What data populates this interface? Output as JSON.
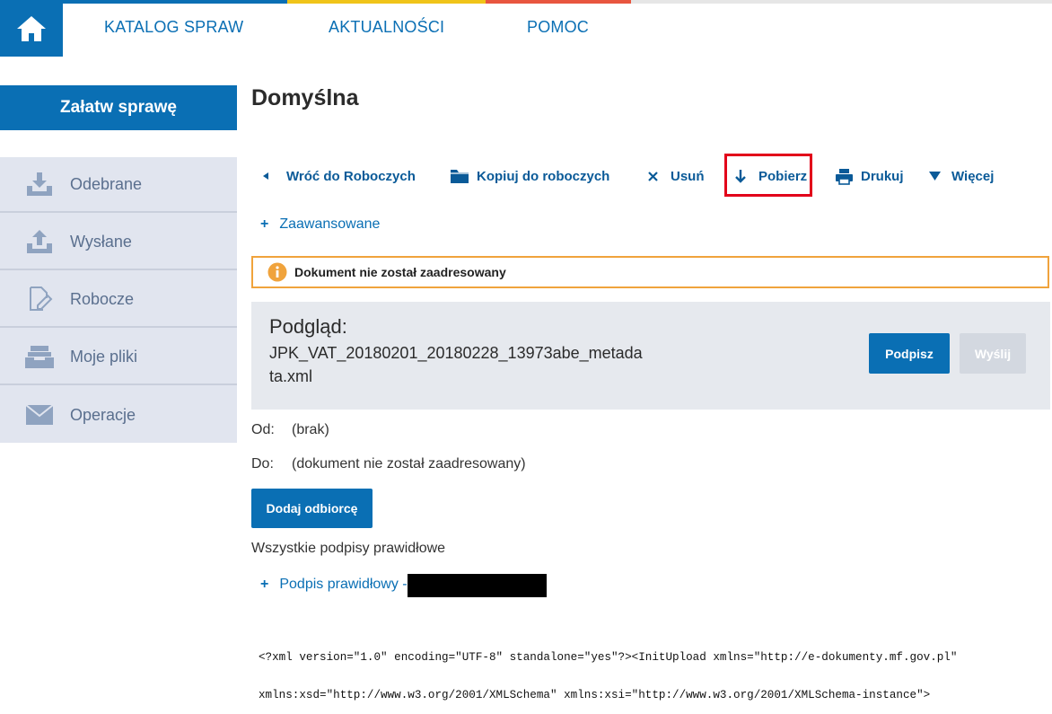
{
  "nav": {
    "home_icon": "house-icon",
    "items": [
      "KATALOG SPRAW",
      "AKTUALNOŚCI",
      "POMOC"
    ],
    "stripe_colors": [
      "#0a6fb4",
      "#f0c419",
      "#e8563f",
      "#e6e6e6"
    ]
  },
  "sidebar": {
    "settle_button": "Załatw sprawę",
    "items": [
      {
        "label": "Odebrane",
        "icon": "inbox-download-icon"
      },
      {
        "label": "Wysłane",
        "icon": "upload-icon"
      },
      {
        "label": "Robocze",
        "icon": "edit-document-icon"
      },
      {
        "label": "Moje pliki",
        "icon": "file-tray-icon"
      },
      {
        "label": "Operacje",
        "icon": "envelope-icon"
      }
    ]
  },
  "page": {
    "title": "Domyślna"
  },
  "toolbar": {
    "back": "Wróć do Roboczych",
    "copy": "Kopiuj do roboczych",
    "delete": "Usuń",
    "download": "Pobierz",
    "print": "Drukuj",
    "more": "Więcej"
  },
  "advanced": "Zaawansowane",
  "warning": "Dokument nie został zaadresowany",
  "preview": {
    "heading": "Podgląd:",
    "filename": "JPK_VAT_20180201_20180228_13973abe_metadata.xml",
    "sign_button": "Podpisz",
    "send_button": "Wyślij"
  },
  "meta": {
    "from_label": "Od:",
    "from_value": "(brak)",
    "to_label": "Do:",
    "to_value": "(dokument nie został zaadresowany)"
  },
  "add_recipient": "Dodaj odbiorcę",
  "signatures": {
    "summary": "Wszystkie podpisy prawidłowe",
    "item": "Podpis prawidłowy -"
  },
  "xml_lines": [
    "<?xml version=\"1.0\" encoding=\"UTF-8\" standalone=\"yes\"?><InitUpload xmlns=\"http://e-dokumenty.mf.gov.pl\"",
    "xmlns:xsd=\"http://www.w3.org/2001/XMLSchema\" xmlns:xsi=\"http://www.w3.org/2001/XMLSchema-instance\">"
  ],
  "colors": {
    "accent": "#0a6fb4",
    "warning_border": "#f0a33c",
    "highlight": "#e2001a"
  }
}
